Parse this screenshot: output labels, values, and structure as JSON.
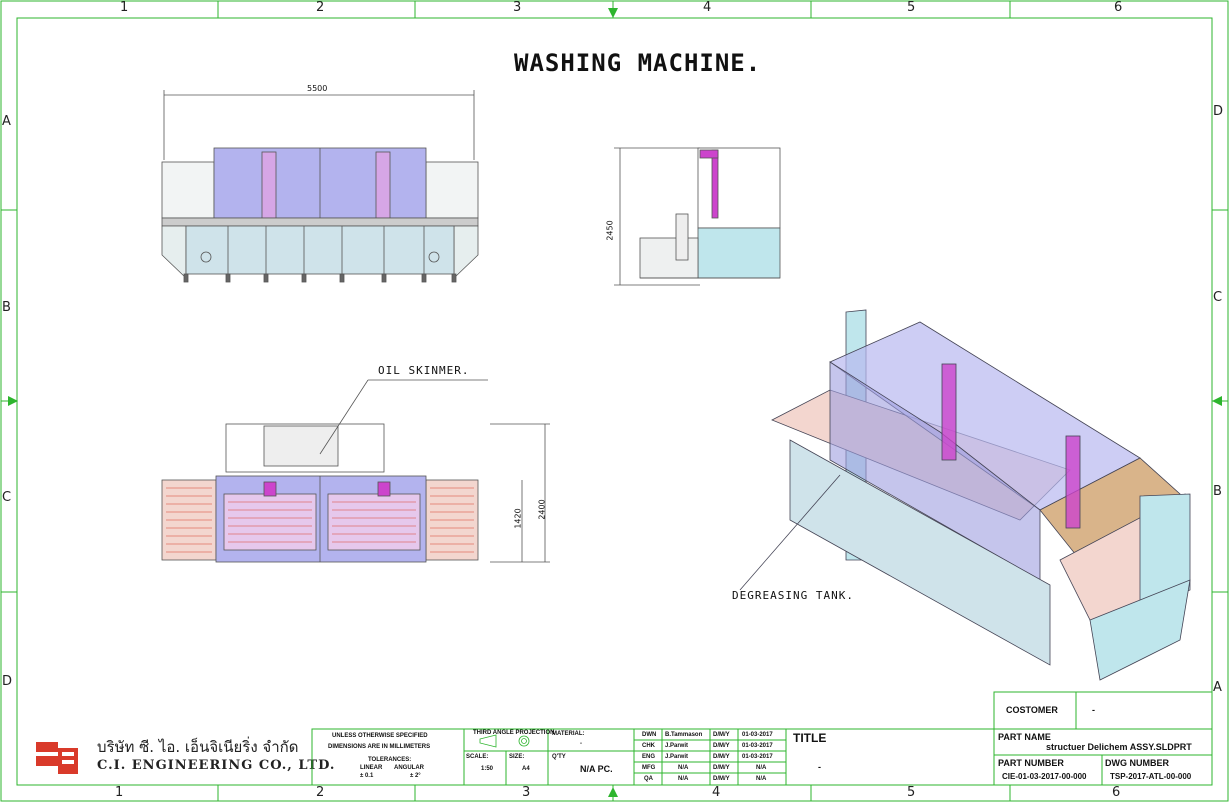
{
  "drawing": {
    "title": "WASHING MACHINE.",
    "notes": {
      "oil_skimmer": "OIL SKINMER.",
      "degreasing_tank": "DEGREASING TANK."
    },
    "dimensions": {
      "front_width": "5500",
      "side_height": "2450",
      "top_height_total": "2400",
      "top_height_partial": "1420"
    }
  },
  "border": {
    "columns": [
      "1",
      "2",
      "3",
      "4",
      "5",
      "6"
    ],
    "rows_left": [
      "A",
      "B",
      "C",
      "D"
    ],
    "rows_right": [
      "D",
      "C",
      "B",
      "A"
    ]
  },
  "company": {
    "name_thai": "บริษัท ซี. ไอ. เอ็นจิเนียริ่ง จำกัด",
    "name_en": "C.I. ENGINEERING CO., LTD."
  },
  "title_block": {
    "spec_line1": "UNLESS OTHERWISE SPECIFIED",
    "spec_line2": "DIMENSIONS ARE IN MILLIMETERS",
    "tolerances": "TOLERANCES:",
    "linear": "LINEAR",
    "angular": "ANGULAR",
    "linear_val": "± 0.1",
    "angular_val": "± 2°",
    "projection": "THIRD ANGLE PROJECTION",
    "scale_label": "SCALE:",
    "scale_val": "1:50",
    "size_label": "SIZE:",
    "size_val": "A4",
    "material_label": "MATERIAL:",
    "material_val": "-",
    "qty_label": "Q'TY",
    "qty_val": "N/A PC.",
    "approvals": [
      {
        "role": "DWN",
        "name": "B.Tammason",
        "date_label": "D/M/Y",
        "date": "01-03-2017"
      },
      {
        "role": "CHK",
        "name": "J.Parwit",
        "date_label": "D/M/Y",
        "date": "01-03-2017"
      },
      {
        "role": "ENG",
        "name": "J.Parwit",
        "date_label": "D/M/Y",
        "date": "01-03-2017"
      },
      {
        "role": "MFG",
        "name": "N/A",
        "date_label": "D/M/Y",
        "date": "N/A"
      },
      {
        "role": "QA",
        "name": "N/A",
        "date_label": "D/M/Y",
        "date": "N/A"
      }
    ],
    "title_label": "TITLE",
    "title_val": "-",
    "customer_label": "COSTOMER",
    "customer_val": "-",
    "part_name_label": "PART NAME",
    "part_name_val": "structuer  Delichem  ASSY.SLDPRT",
    "part_number_label": "PART NUMBER",
    "part_number_val": "CIE-01-03-2017-00-000",
    "dwg_number_label": "DWG NUMBER",
    "dwg_number_val": "TSP-2017-ATL-00-000"
  },
  "colors": {
    "frame_green": "#2db52d",
    "panel_blue": "#a8a8e8",
    "tank_cyan": "#bfe6ec",
    "mesh_red": "#d9412a",
    "arm_magenta": "#cc44cc"
  }
}
